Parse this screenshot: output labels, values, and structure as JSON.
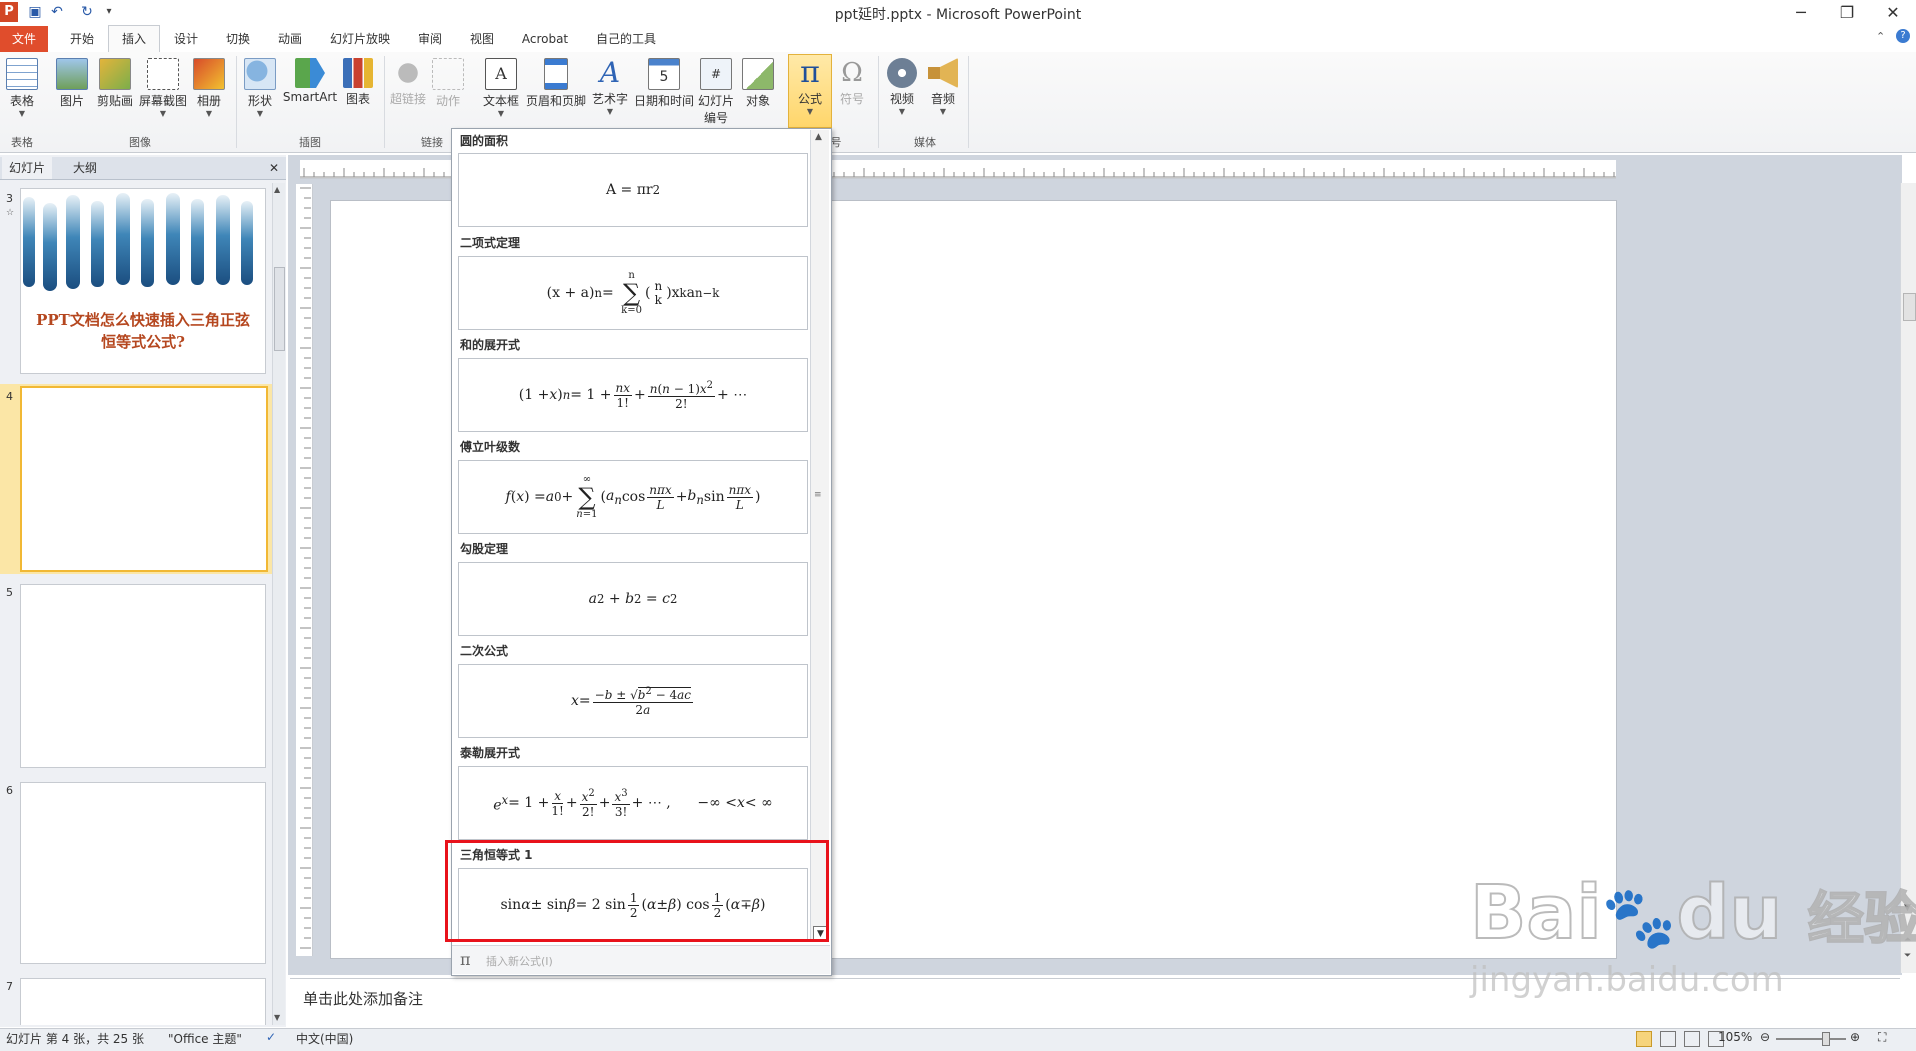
{
  "window": {
    "title": "ppt延时.pptx - Microsoft PowerPoint",
    "app_icon": "P",
    "controls": [
      "─",
      "❐",
      "✕"
    ]
  },
  "qat": {
    "save_icon": "▣",
    "undo_icon": "↶",
    "redo_icon": "↻",
    "more_icon": "▾"
  },
  "tabs": [
    "文件",
    "开始",
    "插入",
    "设计",
    "切换",
    "动画",
    "幻灯片放映",
    "审阅",
    "视图",
    "Acrobat",
    "自己的工具"
  ],
  "active_tab": "插入",
  "ribbon": {
    "buttons": {
      "table": "表格",
      "picture": "图片",
      "clipart": "剪贴画",
      "screenshot": "屏幕截图",
      "album": "相册",
      "shapes": "形状",
      "smartart": "SmartArt",
      "chart": "图表",
      "hyperlink": "超链接",
      "action": "动作",
      "textbox": "文本框",
      "headerfooter": "页眉和页脚",
      "wordart": "艺术字",
      "datetime": "日期和时间",
      "slidenum_1": "幻灯片",
      "slidenum_2": "编号",
      "object": "对象",
      "equation": "公式",
      "symbol": "符号",
      "video": "视频",
      "audio": "音频"
    },
    "groups": {
      "tables": "表格",
      "images": "图像",
      "illustrations": "插图",
      "links": "链接",
      "symbols_tail": "号",
      "media": "媒体"
    }
  },
  "left_panel": {
    "tab_slides": "幻灯片",
    "tab_outline": "大纲",
    "close": "✕",
    "slides": [
      {
        "number": "3",
        "title": "PPT文档怎么快速插入三角正弦恒等式公式?"
      },
      {
        "number": "4"
      },
      {
        "number": "5"
      },
      {
        "number": "6"
      },
      {
        "number": "7"
      }
    ]
  },
  "equations": {
    "headers": [
      "圆的面积",
      "二项式定理",
      "和的展开式",
      "傅立叶级数",
      "勾股定理",
      "二次公式",
      "泰勒展开式",
      "三角恒等式 1"
    ],
    "insert_new": "插入新公式(I)",
    "pi_icon": "π"
  },
  "notes_placeholder": "单击此处添加备注",
  "statusbar": {
    "slide_info": "幻灯片 第 4 张，共 25 张",
    "theme": "\"Office 主题\"",
    "language": "中文(中国)",
    "zoom": "105%"
  },
  "watermark": {
    "brand": "Bai",
    "brand2": "du",
    "brand_cn": "经验",
    "url": "jingyan.baidu.com"
  }
}
